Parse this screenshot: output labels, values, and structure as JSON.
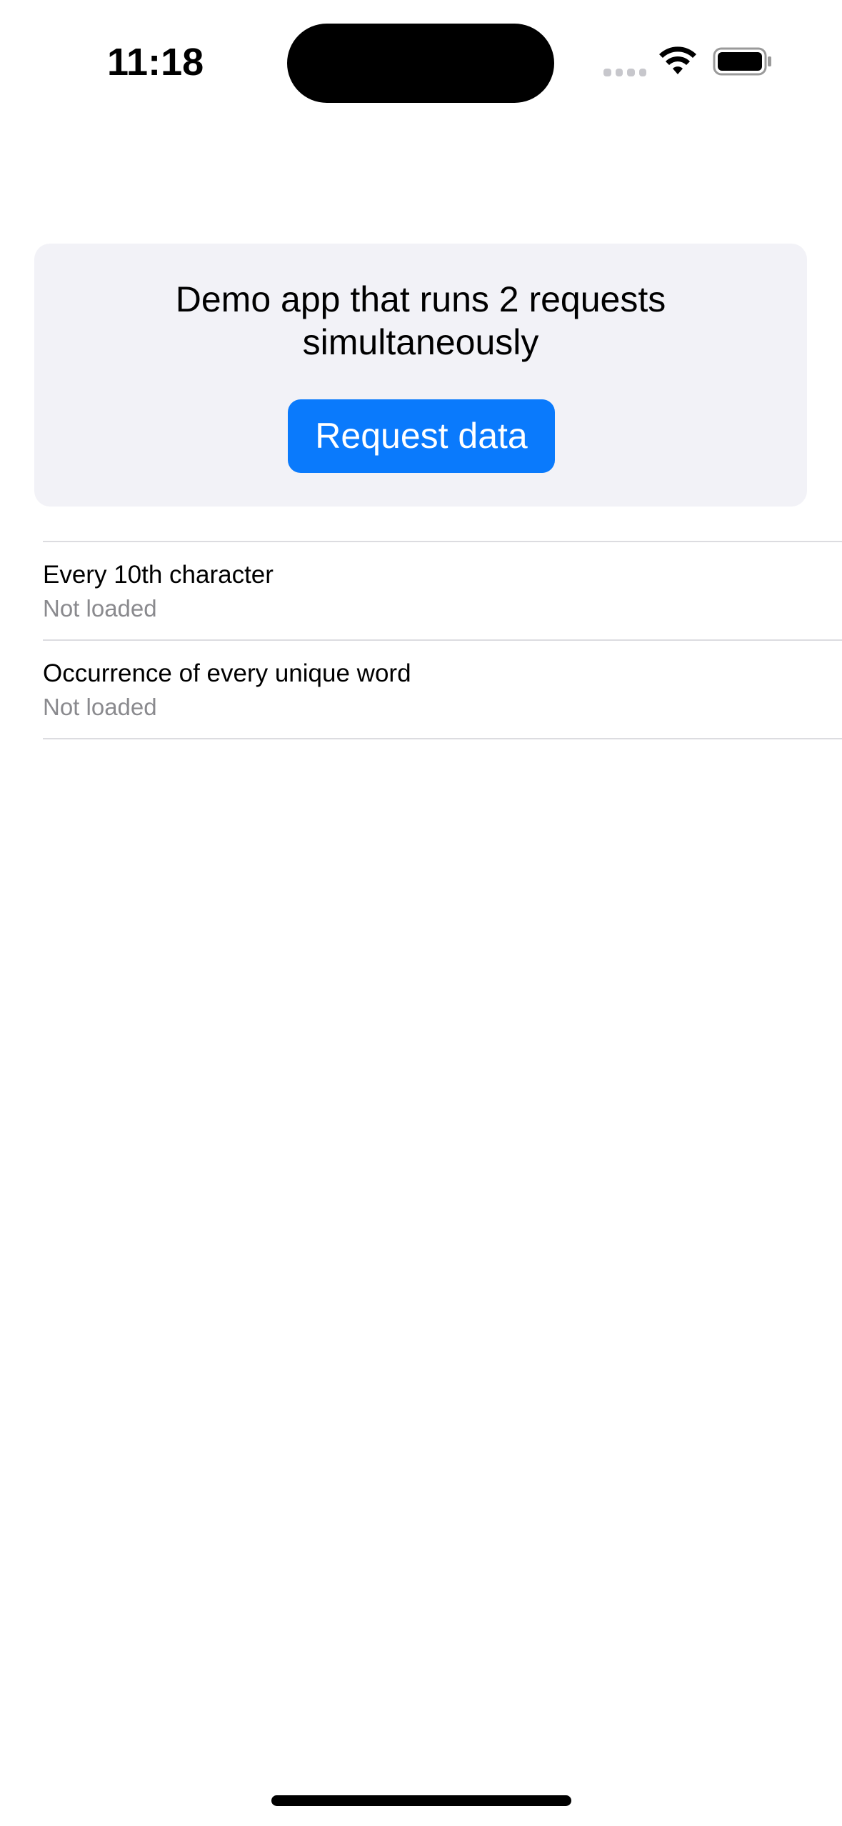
{
  "status_bar": {
    "time": "11:18",
    "icons": [
      "cellular-signal-icon",
      "wifi-icon",
      "battery-icon"
    ]
  },
  "card": {
    "title": "Demo app that runs 2 requests simultaneously",
    "button_label": "Request data",
    "button_color": "#0a7afc",
    "background_color": "#f2f2f7"
  },
  "list": {
    "items": [
      {
        "title": "Every 10th character",
        "subtitle": "Not loaded"
      },
      {
        "title": "Occurrence of every unique word",
        "subtitle": "Not loaded"
      }
    ]
  }
}
